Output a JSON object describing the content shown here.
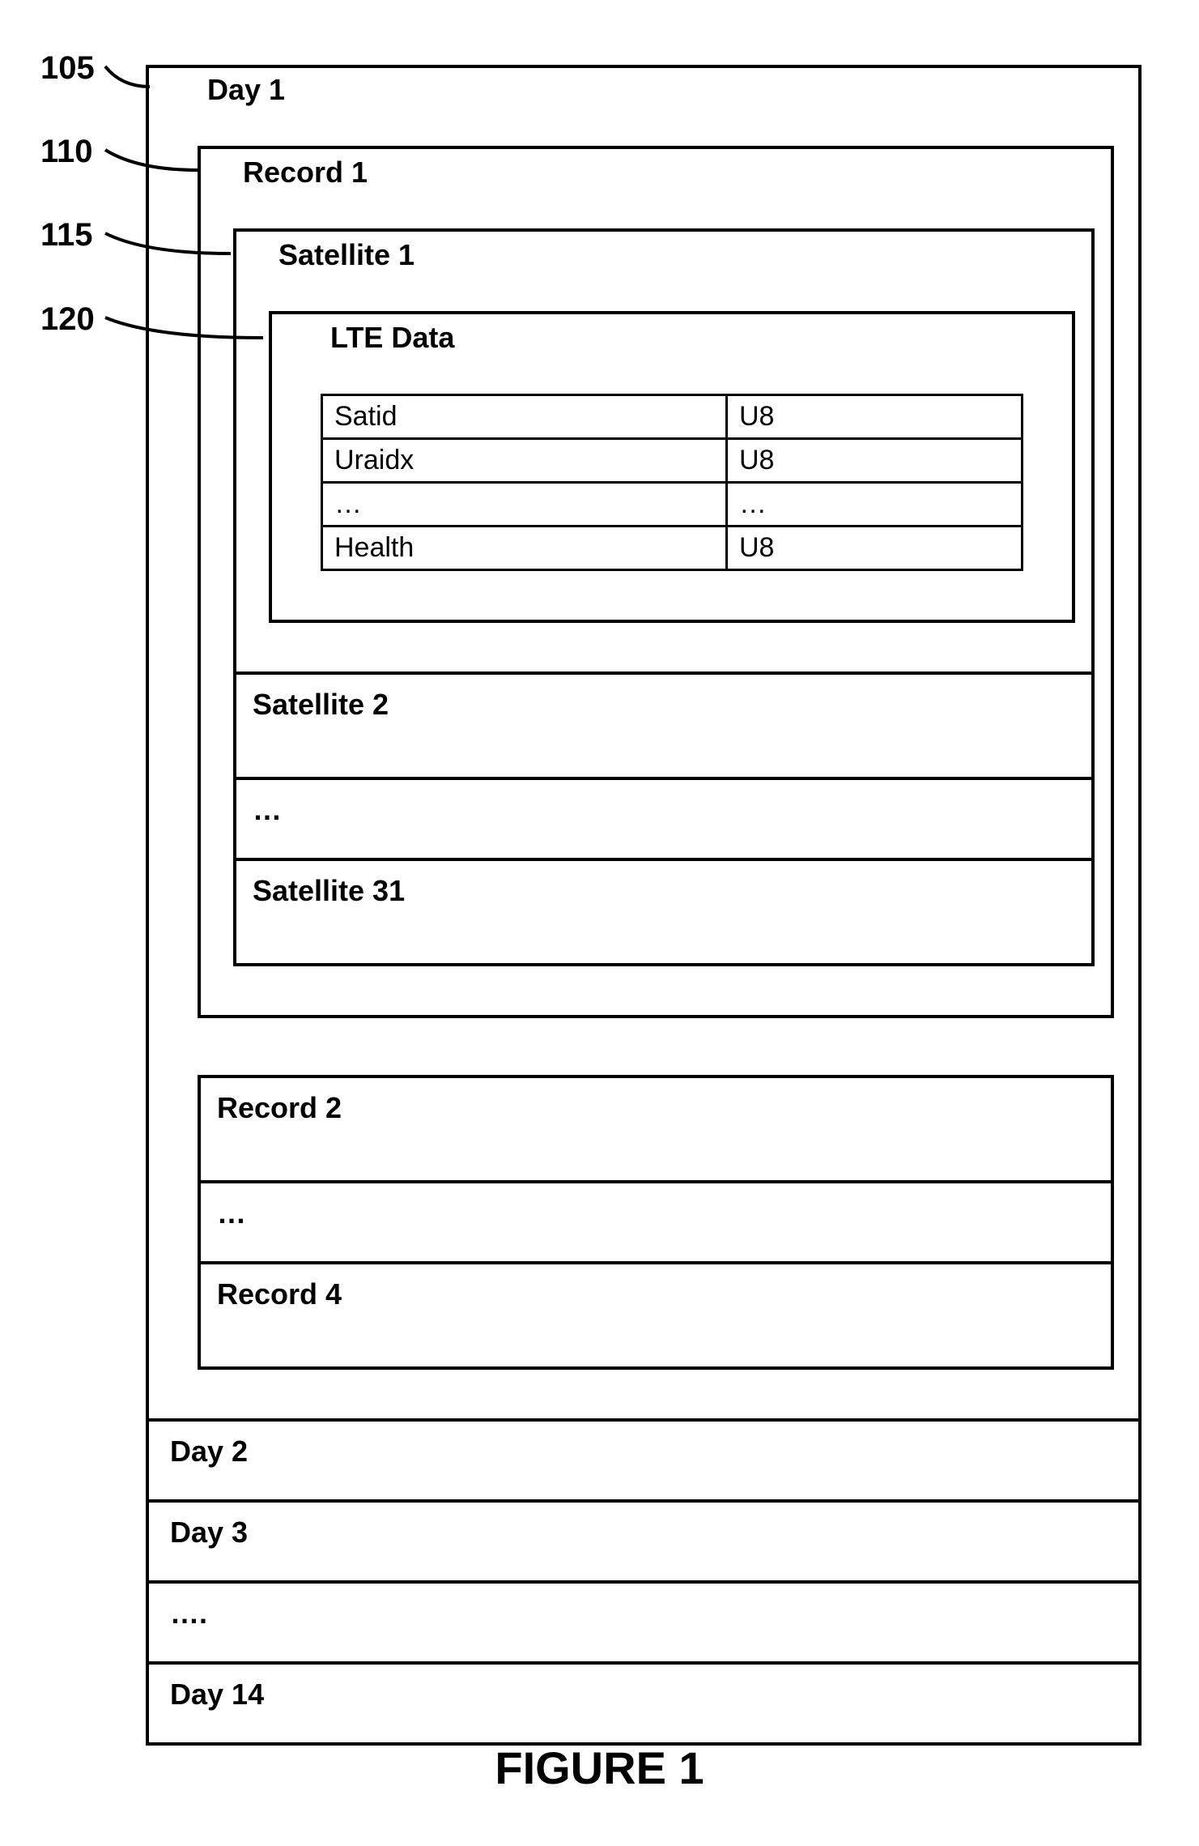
{
  "callouts": {
    "c105": "105",
    "c110": "110",
    "c115": "115",
    "c120": "120"
  },
  "day1": {
    "label": "Day 1",
    "record1": {
      "label": "Record 1",
      "sat1": {
        "label": "Satellite 1",
        "lte": {
          "label": "LTE Data",
          "rows": [
            {
              "k": "Satid",
              "v": "U8"
            },
            {
              "k": "Uraidx",
              "v": "U8"
            },
            {
              "k": "…",
              "v": "…"
            },
            {
              "k": "Health",
              "v": "U8"
            }
          ]
        }
      },
      "sat_more": [
        "Satellite 2",
        "…",
        "Satellite 31"
      ]
    },
    "rec_more": [
      "Record 2",
      "…",
      "Record 4"
    ]
  },
  "days_more": [
    "Day 2",
    "Day 3",
    "….",
    "Day 14"
  ],
  "figure_caption": "FIGURE 1"
}
